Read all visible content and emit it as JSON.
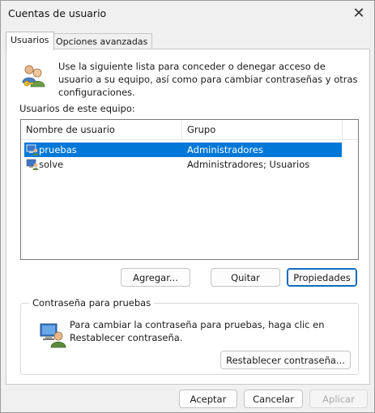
{
  "window": {
    "title": "Cuentas de usuario"
  },
  "tabs": [
    {
      "label": "Usuarios",
      "active": true
    },
    {
      "label": "Opciones avanzadas",
      "active": false
    }
  ],
  "intro_text": "Use la siguiente lista para conceder o denegar acceso de usuario a su equipo, así como para cambiar contraseñas y otras configuraciones.",
  "users_list": {
    "label": "Usuarios de este equipo:",
    "columns": [
      "Nombre de usuario",
      "Grupo"
    ],
    "rows": [
      {
        "name": "pruebas",
        "group": "Administradores",
        "selected": true
      },
      {
        "name": "solve",
        "group": "Administradores; Usuarios",
        "selected": false
      }
    ]
  },
  "list_buttons": {
    "add": "Agregar...",
    "remove": "Quitar",
    "properties": "Propiedades"
  },
  "password_group": {
    "legend": "Contraseña para pruebas",
    "text": "Para cambiar la contraseña para pruebas, haga clic en Restablecer contraseña.",
    "reset_button": "Restablecer contraseña..."
  },
  "footer_buttons": {
    "ok": "Aceptar",
    "cancel": "Cancelar",
    "apply": "Aplicar"
  },
  "colors": {
    "selection": "#0078d7",
    "default_button_border": "#0f6cbd"
  }
}
